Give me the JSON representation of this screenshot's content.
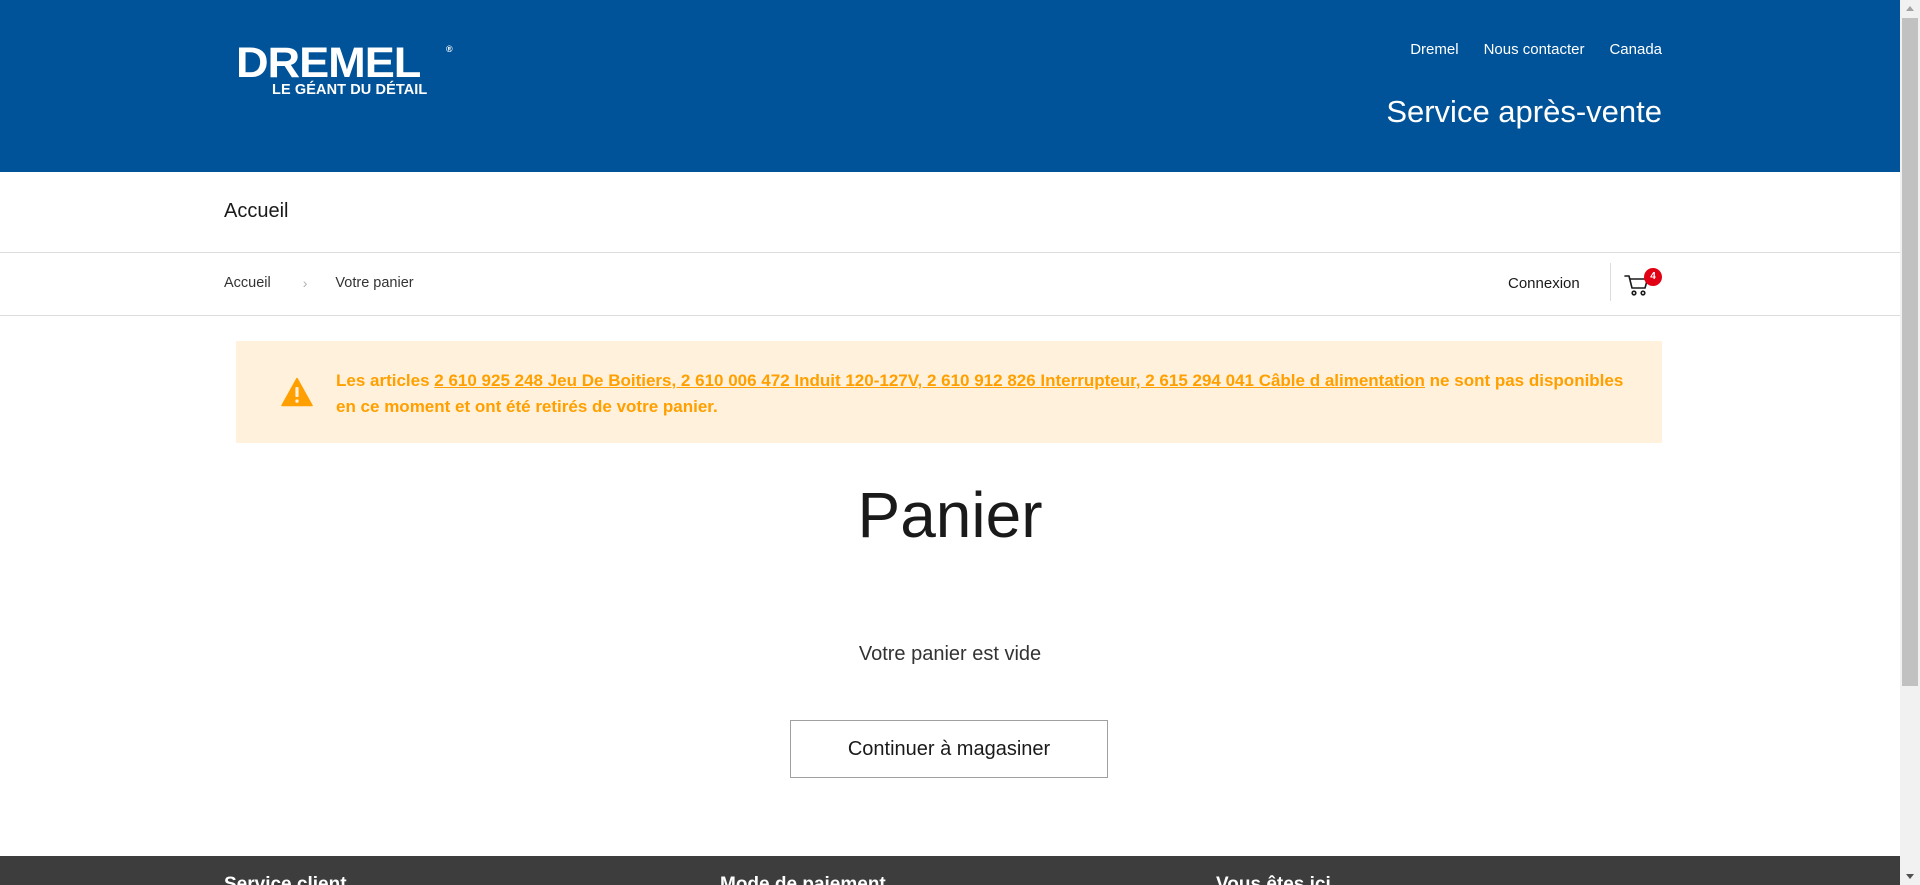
{
  "header": {
    "logo_text": "DREMEL",
    "logo_tagline": "LE GÉANT DU DÉTAIL",
    "links": [
      "Dremel",
      "Nous contacter",
      "Canada"
    ],
    "service_title": "Service après-vente"
  },
  "nav": {
    "home": "Accueil"
  },
  "breadcrumb": {
    "home": "Accueil",
    "current": "Votre panier"
  },
  "account": {
    "login": "Connexion",
    "cart_count": "4"
  },
  "alert": {
    "prefix": "Les articles ",
    "items": "2 610 925 248 Jeu De Boitiers, 2 610 006 472 Induit 120-127V, 2 610 912 826 Interrupteur, 2 615 294 041 Câble d alimentation",
    "suffix": " ne sont pas disponibles en ce moment et ont été retirés de votre panier."
  },
  "main": {
    "title": "Panier",
    "empty_message": "Votre panier est vide",
    "continue_button": "Continuer à magasiner"
  },
  "footer": {
    "columns": [
      "Service client",
      "Mode de paiement",
      "Vous êtes ici"
    ]
  },
  "colors": {
    "header_bg": "#005398",
    "alert_bg": "#fff1db",
    "alert_text": "#ffa000",
    "badge": "#e20015",
    "footer_bg": "#3d3d3d"
  },
  "icons": [
    "warning-icon",
    "cart-icon",
    "chevron-right-icon"
  ]
}
